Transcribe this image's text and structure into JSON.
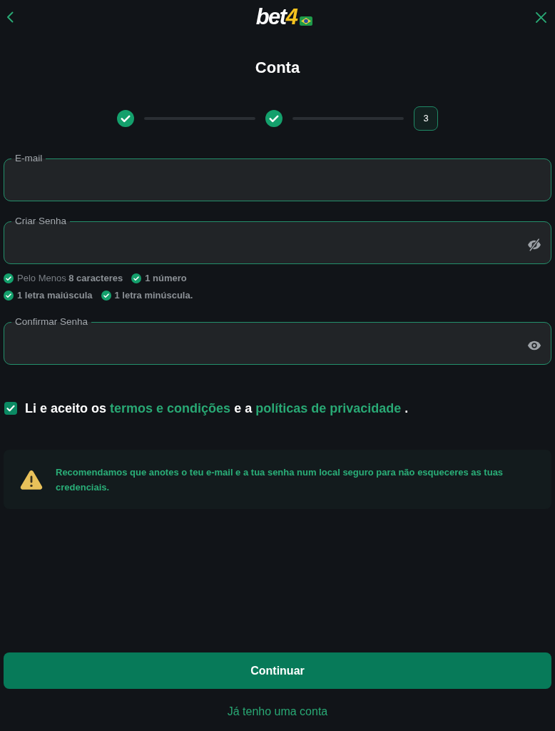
{
  "header": {
    "logo": {
      "text": "bet",
      "accent": "4"
    }
  },
  "title": "Conta",
  "stepper": {
    "steps": [
      {
        "completed": true
      },
      {
        "completed": true
      },
      {
        "completed": false,
        "label": "3"
      }
    ]
  },
  "fields": [
    {
      "kind": "email",
      "label": "E-mail"
    },
    {
      "kind": "password",
      "label": "Criar Senha",
      "revealed": true,
      "rule_rows": [
        {
          "rules": [
            {
              "prefix": "Pelo Menos",
              "text": "8 caracteres",
              "met": true
            },
            {
              "text": "1 número",
              "met": true
            }
          ]
        },
        {
          "rules": [
            {
              "text": "1 letra maiúscula",
              "met": true
            },
            {
              "text": "1 letra minúscula.",
              "met": true
            }
          ]
        }
      ]
    },
    {
      "kind": "password",
      "label": "Confirmar Senha",
      "revealed": false
    }
  ],
  "terms": {
    "checked": true,
    "parts": [
      {
        "kind": "text",
        "text": "Li e aceito os"
      },
      {
        "kind": "link",
        "text": "termos e condições"
      },
      {
        "kind": "text",
        "text": "e a"
      },
      {
        "kind": "link",
        "text": "políticas de privacidade"
      },
      {
        "kind": "text",
        "text": "."
      }
    ]
  },
  "notice": {
    "kind": "warning",
    "text": "Recomendamos que anotes o teu e-mail e a tua senha num local seguro para não esqueceres as tuas credenciais."
  },
  "primary_button": "Continuar",
  "login_link": "Já tenho uma conta"
}
